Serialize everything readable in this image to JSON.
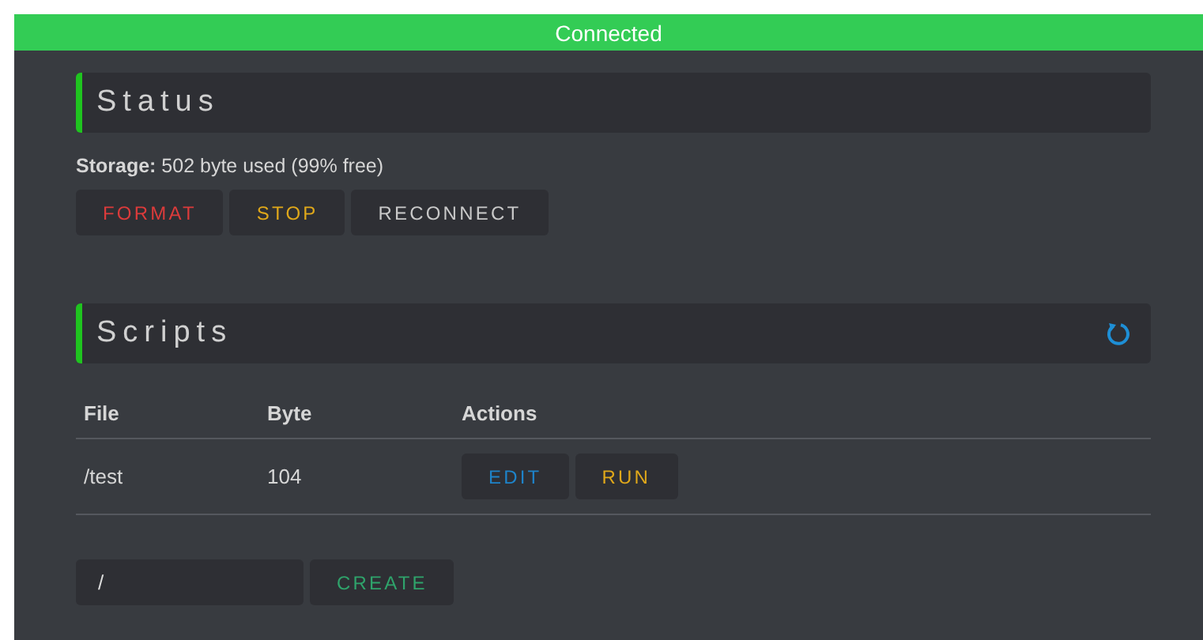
{
  "status_bar": {
    "text": "Connected",
    "connected": true
  },
  "status": {
    "title": "Status",
    "storage": "**Storage:** 502 byte used (99% free)",
    "buttons": [
      {
        "label": "FORMAT",
        "kind": "danger"
      },
      {
        "label": "STOP",
        "kind": "warning"
      },
      {
        "label": "RECONNECT",
        "kind": "neutral"
      }
    ]
  },
  "scripts": {
    "title": "Scripts",
    "table": {
      "columns": [
        "File",
        "Byte",
        "Actions"
      ],
      "rows": [
        {
          "file": "/test",
          "byte": "104",
          "actions": [
            {
              "label": "EDIT",
              "kind": "primary"
            },
            {
              "label": "RUN",
              "kind": "warning"
            }
          ]
        }
      ]
    },
    "new_file": {
      "value": "/",
      "button": {
        "label": "CREATE",
        "kind": "success"
      }
    }
  }
}
